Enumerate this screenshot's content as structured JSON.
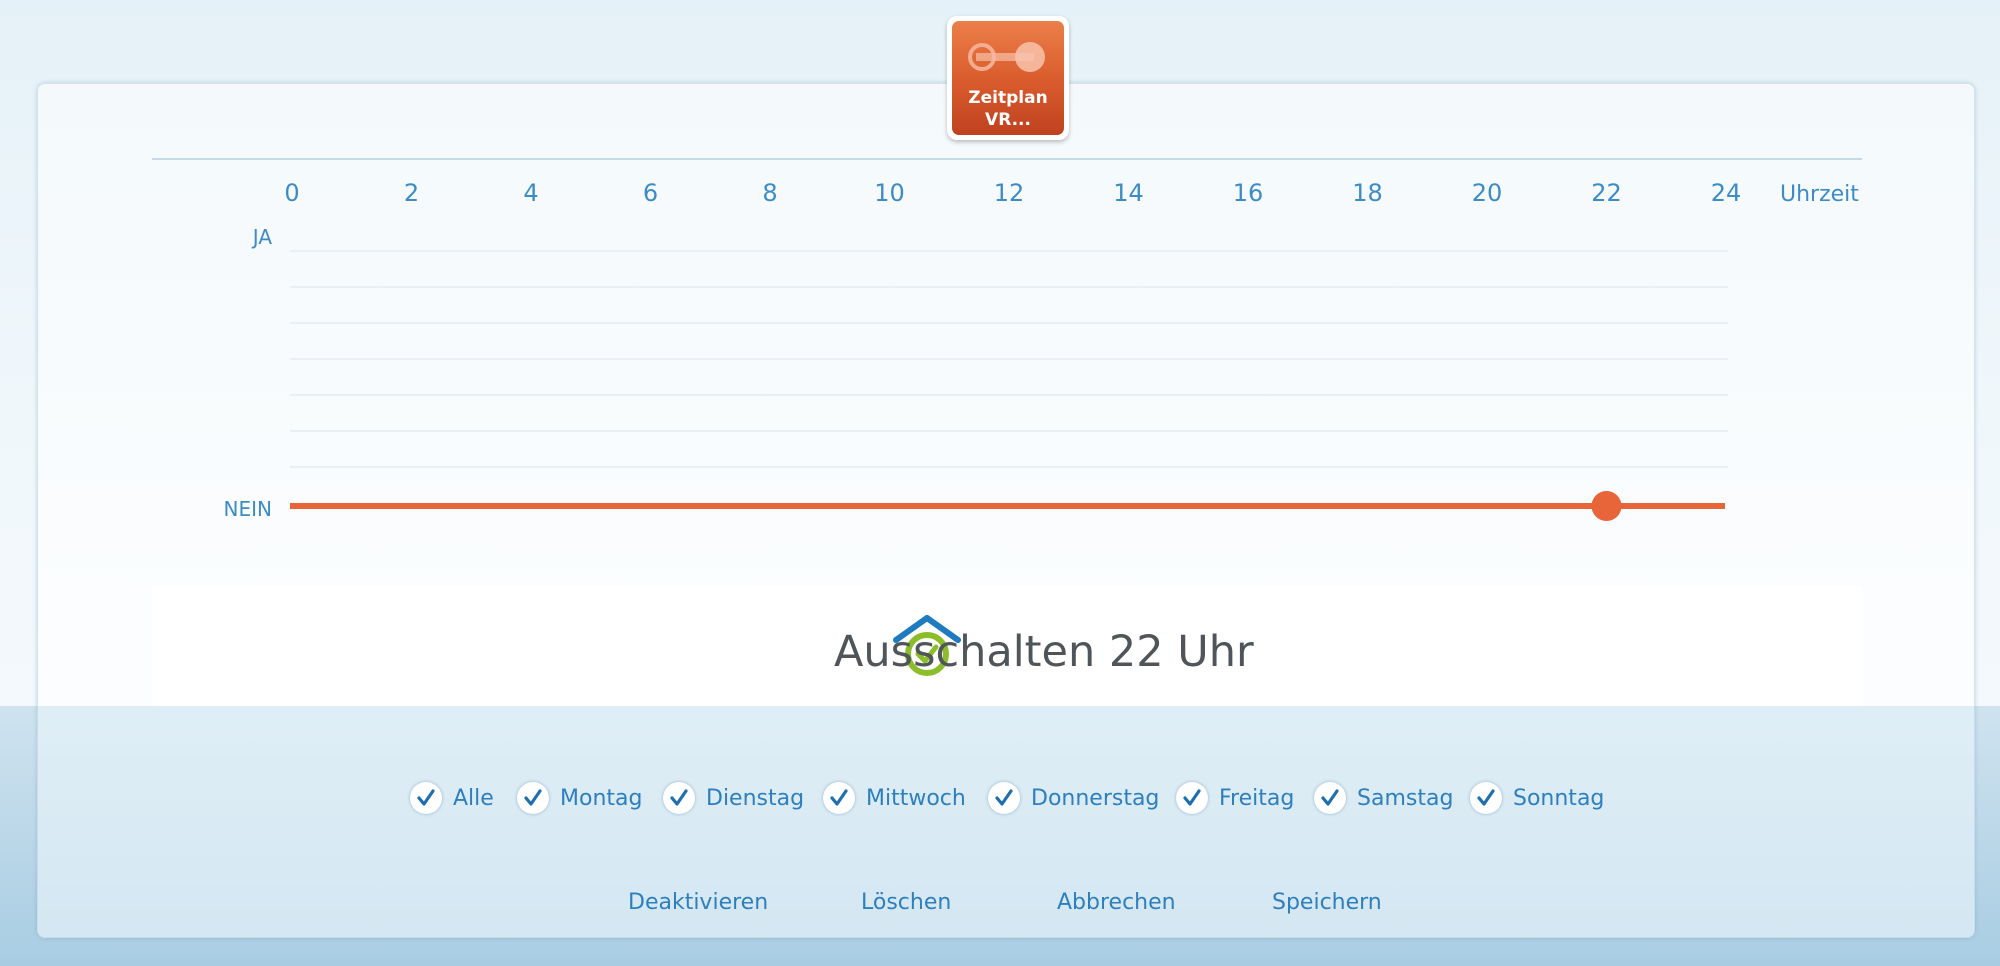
{
  "device": {
    "icon": "switch-toggle-icon",
    "label_line1": "Zeitplan",
    "label_line2": "VR..."
  },
  "schedule_chart": {
    "x_axis_label": "Uhrzeit",
    "x_ticks": [
      "0",
      "2",
      "4",
      "6",
      "8",
      "10",
      "12",
      "14",
      "16",
      "18",
      "20",
      "22",
      "24"
    ],
    "y_top_label": "JA",
    "y_bottom_label": "NEIN",
    "line_color": "#e8653a",
    "state_value": "NEIN",
    "point_hour": 22
  },
  "result": {
    "icon": "home-clock-icon",
    "text": "Ausschalten 22 Uhr"
  },
  "days": {
    "all": "Alle",
    "items": [
      "Montag",
      "Dienstag",
      "Mittwoch",
      "Donnerstag",
      "Freitag",
      "Samstag",
      "Sonntag"
    ],
    "checked": true
  },
  "actions": {
    "deactivate": "Deaktivieren",
    "delete": "Löschen",
    "cancel": "Abbrechen",
    "save": "Speichern"
  },
  "colors": {
    "accent": "#2e7fbd",
    "line": "#e8653a",
    "tile": "#d85a2c",
    "icon_green": "#8cbd2a",
    "icon_blue": "#1f7bbf"
  }
}
